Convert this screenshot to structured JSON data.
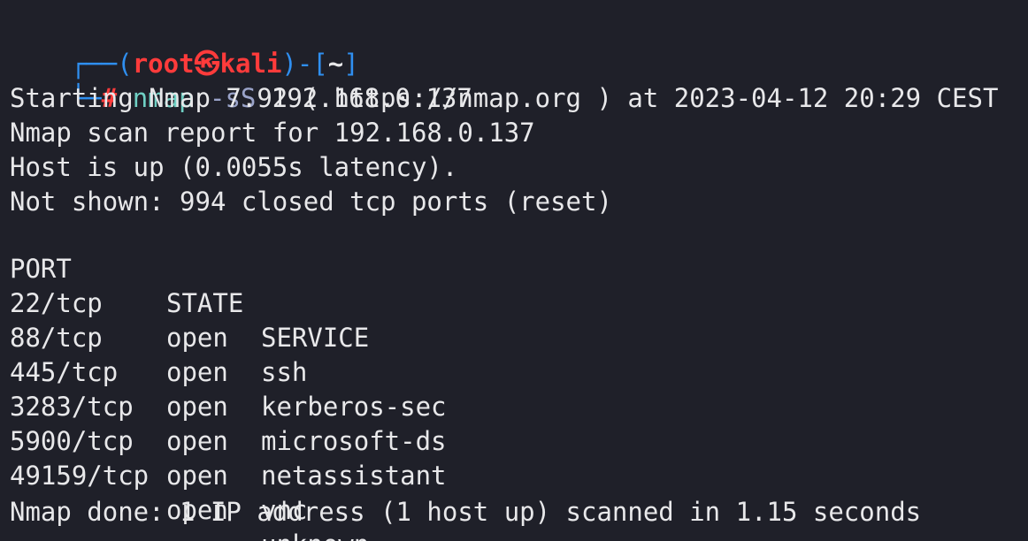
{
  "prompt": {
    "user": "root",
    "skull": "㉿",
    "host": "kali",
    "dir": "~",
    "hash": "#",
    "command": "nmap",
    "flag": "-sS",
    "arg": "192.168.0.137"
  },
  "output": {
    "starting": "Starting Nmap 7.92 ( https://nmap.org ) at 2023-04-12 20:29 CEST",
    "report": "Nmap scan report for 192.168.0.137",
    "host_up": "Host is up (0.0055s latency).",
    "not_shown": "Not shown: 994 closed tcp ports (reset)",
    "done": "Nmap done: 1 IP address (1 host up) scanned in 1.15 seconds"
  },
  "table": {
    "headers": {
      "port": "PORT",
      "state": "STATE",
      "service": "SERVICE"
    },
    "rows": [
      {
        "port": "22/tcp",
        "state": "open",
        "service": "ssh"
      },
      {
        "port": "88/tcp",
        "state": "open",
        "service": "kerberos-sec"
      },
      {
        "port": "445/tcp",
        "state": "open",
        "service": "microsoft-ds"
      },
      {
        "port": "3283/tcp",
        "state": "open",
        "service": "netassistant"
      },
      {
        "port": "5900/tcp",
        "state": "open",
        "service": "vnc"
      },
      {
        "port": "49159/tcp",
        "state": "open",
        "service": "unknown"
      }
    ]
  },
  "colors": {
    "background": "#1f2029",
    "text": "#e8e8ea",
    "prompt_frame": "#2f8ff0",
    "prompt_user": "#ff3b3b",
    "command": "#6fd0c4"
  }
}
